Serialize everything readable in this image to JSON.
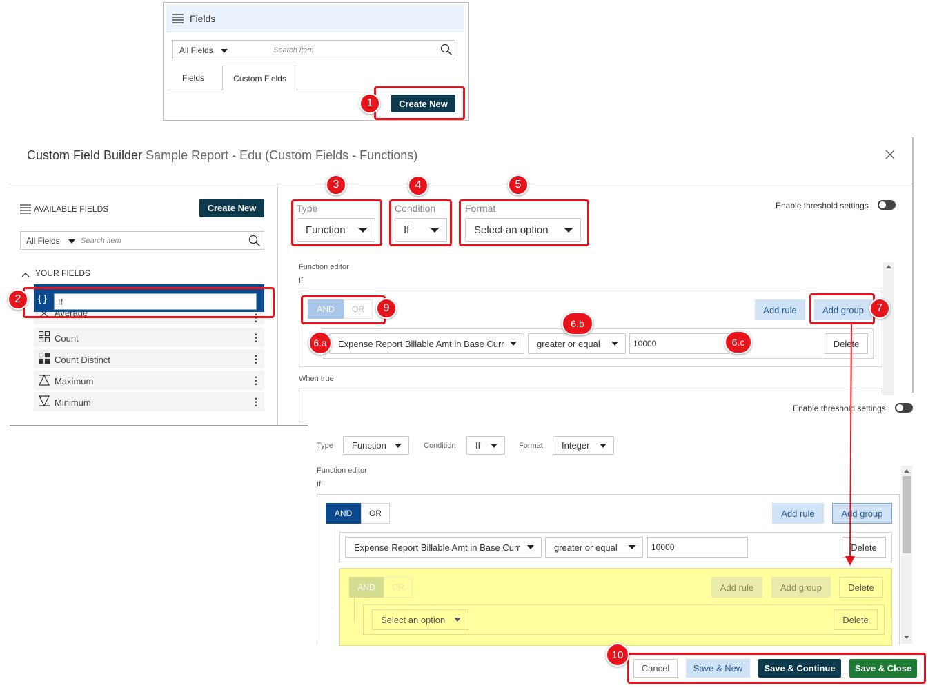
{
  "fields_panel": {
    "title": "Fields",
    "filter_label": "All Fields",
    "search_placeholder": "Search item",
    "tabs": [
      "Fields",
      "Custom Fields"
    ],
    "create_new": "Create New"
  },
  "builder": {
    "title_bold": "Custom Field Builder",
    "title_rest": "Sample Report - Edu (Custom Fields - Functions)",
    "available_fields": "AVAILABLE FIELDS",
    "create_new": "Create New",
    "filter_label": "All Fields",
    "search_placeholder": "Search item",
    "your_fields": "YOUR FIELDS",
    "edit_value": "If",
    "fields": [
      {
        "label": "Average"
      },
      {
        "label": "Count"
      },
      {
        "label": "Count Distinct"
      },
      {
        "label": "Maximum"
      },
      {
        "label": "Minimum"
      }
    ],
    "type_label": "Type",
    "type_value": "Function",
    "condition_label": "Condition",
    "condition_value": "If",
    "format_label": "Format",
    "format_value": "Select an option",
    "threshold": "Enable threshold settings",
    "function_editor": "Function editor",
    "if_label": "If",
    "and": "AND",
    "or": "OR",
    "add_rule": "Add rule",
    "add_group": "Add group",
    "rule_field": "Expense Report Billable Amt in Base Curr",
    "rule_op": "greater or equal",
    "rule_value": "10000",
    "delete": "Delete",
    "when_true": "When true"
  },
  "second": {
    "threshold": "Enable threshold settings",
    "type_label": "Type",
    "type_value": "Function",
    "condition_label": "Condition",
    "condition_value": "If",
    "format_label": "Format",
    "format_value": "Integer",
    "function_editor": "Function editor",
    "if_label": "If",
    "and": "AND",
    "or": "OR",
    "add_rule": "Add rule",
    "add_group": "Add group",
    "rule_field": "Expense Report Billable Amt in Base Curr",
    "rule_op": "greater or equal",
    "rule_value": "10000",
    "delete": "Delete",
    "group_select": "Select an option",
    "cancel": "Cancel",
    "save_new": "Save & New",
    "save_continue": "Save & Continue",
    "save_close": "Save & Close"
  },
  "callouts": [
    "1",
    "2",
    "3",
    "4",
    "5",
    "6.a",
    "6.b",
    "6.c",
    "7",
    "9",
    "10"
  ],
  "colors": {
    "dark_button": "#0e3a4d",
    "annotation_red": "#e8141b",
    "selected_blue": "#0b4a8f",
    "highlight_yellow": "#ffff9e",
    "save_close_green": "#1e7b34"
  }
}
